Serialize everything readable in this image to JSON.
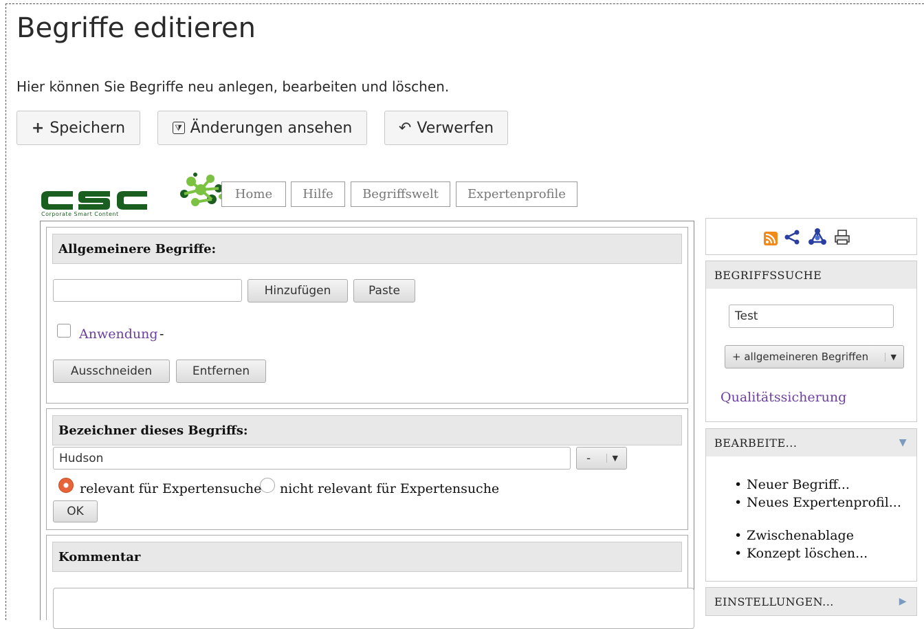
{
  "page": {
    "title": "Begriffe editieren",
    "description": "Hier können Sie Begriffe neu anlegen, bearbeiten und löschen."
  },
  "toolbar": {
    "save_label": "Speichern",
    "changes_label": "Änderungen ansehen",
    "discard_label": "Verwerfen",
    "save_icon": "plus-icon",
    "changes_icon": "diff-icon",
    "discard_icon": "undo-icon"
  },
  "wiki": {
    "logo_text": "CSC",
    "logo_subtitle": "Corporate Smart Content",
    "nav": [
      "Home",
      "Hilfe",
      "Begriffswelt",
      "Expertenprofile"
    ],
    "broader": {
      "heading": "Allgemeinere Begriffe:",
      "input_value": "",
      "add_label": "Hinzufügen",
      "paste_label": "Paste",
      "item_label": "Anwendung",
      "item_suffix": "-",
      "cut_label": "Ausschneiden",
      "remove_label": "Entfernen"
    },
    "labels": {
      "heading": "Bezeichner dieses Begriffs:",
      "value": "Hudson",
      "lang_select": "-",
      "radio_relevant": "relevant für Expertensuche",
      "radio_not_relevant": "nicht relevant für Expertensuche",
      "ok_label": "OK"
    },
    "comment": {
      "heading": "Kommentar"
    }
  },
  "sidebar": {
    "icons": [
      "rss-icon",
      "share-icon",
      "graph-icon",
      "print-icon"
    ],
    "search": {
      "heading": "BEGRIFFSSUCHE",
      "input_value": "Test",
      "dropdown_label": "+ allgemeineren Begriffen",
      "link_label": "Qualitätssicherung"
    },
    "edit": {
      "heading": "BEARBEITE...",
      "items_a": [
        "Neuer Begriff...",
        "Neues Expertenprofil..."
      ],
      "items_b": [
        "Zwischenablage",
        "Konzept löschen..."
      ]
    },
    "settings": {
      "heading": "EINSTELLUNGEN..."
    }
  },
  "colors": {
    "link": "#6b3fa0",
    "logo_green": "#1a5e20",
    "radio_active": "#e7643a",
    "rss": "#f28a1a"
  }
}
